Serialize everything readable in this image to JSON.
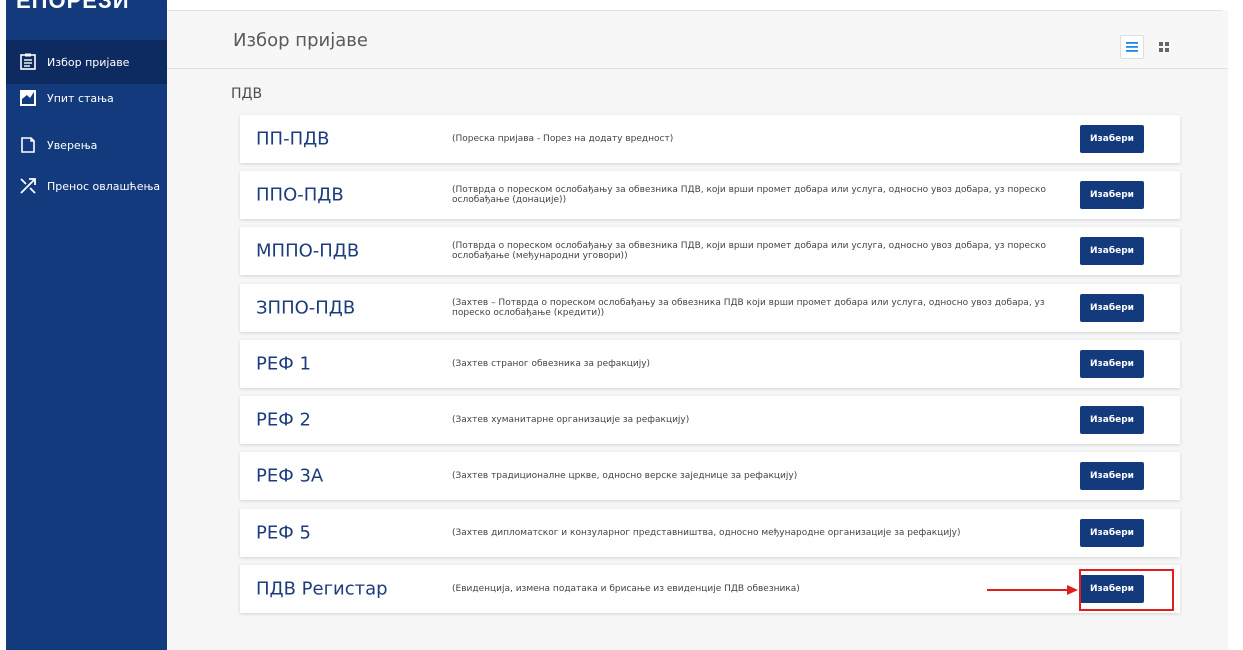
{
  "sidebar": {
    "logo": "ЕПОРЕЗИ",
    "items": [
      {
        "label": "Избор пријаве",
        "icon": "form-list-icon",
        "active": true
      },
      {
        "label": "Упит стања",
        "icon": "chart-icon",
        "active": false
      },
      {
        "label": "Уверења",
        "icon": "document-icon",
        "active": false
      },
      {
        "label": "Пренос овлашћења",
        "icon": "transfer-icon",
        "active": false
      }
    ]
  },
  "header": {
    "title": "Избор пријаве",
    "view_list_icon": "list-view-icon",
    "view_grid_icon": "grid-view-icon"
  },
  "section": {
    "label": "ПДВ"
  },
  "forms": [
    {
      "code": "ПП-ПДВ",
      "description": "(Пореска пријава - Порез на додату вредност)",
      "button": "Изабери"
    },
    {
      "code": "ППО-ПДВ",
      "description": "(Потврда о пореском ослобађању за обвезника ПДВ, који врши промет добара или услуга, односно увоз добара, уз пореско ослобађање (донације))",
      "button": "Изабери"
    },
    {
      "code": "МППО-ПДВ",
      "description": "(Потврда о пореском ослобађању за обвезника ПДВ, који врши промет добара или услуга, односно увоз добара, уз пореско ослобађање (међународни уговори))",
      "button": "Изабери"
    },
    {
      "code": "ЗППО-ПДВ",
      "description": "(Захтев – Потврда о пореском ослобађању за обвезника ПДВ који врши промет добара или услуга, односно увоз добара, уз пореско ослобађање (кредити))",
      "button": "Изабери"
    },
    {
      "code": "РЕФ 1",
      "description": "(Захтев страног обвезника за рефакцију)",
      "button": "Изабери"
    },
    {
      "code": "РЕФ 2",
      "description": "(Захтев хуманитарне организације за рефакцију)",
      "button": "Изабери"
    },
    {
      "code": "РЕФ 3А",
      "description": "(Захтев традиционалне цркве, односно верске заједнице за рефакцију)",
      "button": "Изабери"
    },
    {
      "code": "РЕФ 5",
      "description": "(Захтев дипломатског и конзуларног представништва, односно међународне организације за рефакцију)",
      "button": "Изабери"
    },
    {
      "code": "ПДВ Регистар",
      "description": "(Евиденција, измена података и брисање из евиденције ПДВ обвезника)",
      "button": "Изабери",
      "highlighted": true
    }
  ],
  "colors": {
    "sidebar": "#123a7c",
    "accent": "#1c3c7e",
    "highlight": "#e11d1d"
  }
}
